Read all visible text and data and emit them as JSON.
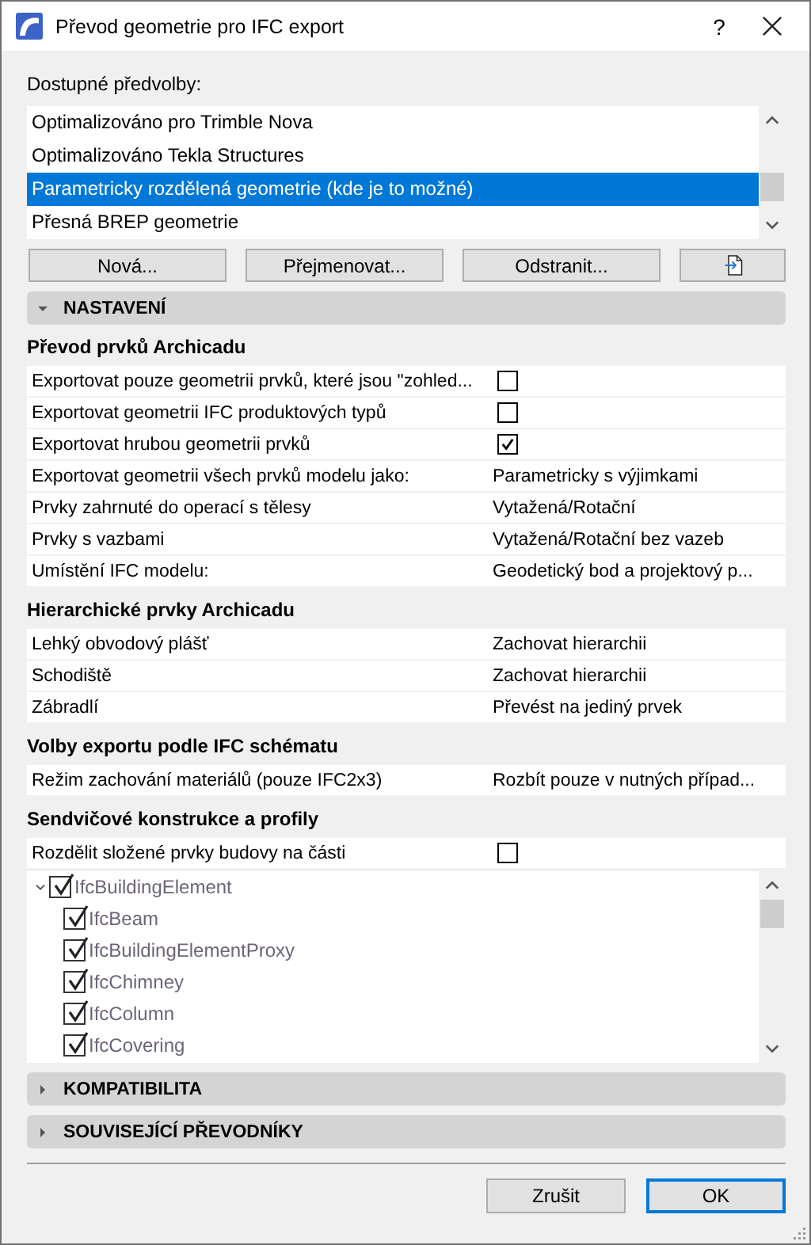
{
  "window": {
    "title": "Převod geometrie pro IFC export",
    "help": "?"
  },
  "presets": {
    "label": "Dostupné předvolby:",
    "items": [
      {
        "label": "Optimalizováno pro Trimble Nova",
        "selected": false
      },
      {
        "label": "Optimalizováno Tekla Structures",
        "selected": false
      },
      {
        "label": "Parametricky rozdělená geometrie (kde je to možné)",
        "selected": true
      },
      {
        "label": "Přesná BREP geometrie",
        "selected": false
      }
    ]
  },
  "preset_buttons": [
    "Nová...",
    "Přejmenovat...",
    "Odstranit..."
  ],
  "sections": [
    {
      "title": "NASTAVENÍ",
      "expanded": true,
      "groups": [
        {
          "title": "Převod prvků Archicadu",
          "rows": [
            {
              "kind": "checkbox",
              "label": "Exportovat pouze geometrii prvků, které jsou \"zohled...",
              "checked": false
            },
            {
              "kind": "checkbox",
              "label": "Exportovat geometrii IFC produktových typů",
              "checked": false
            },
            {
              "kind": "checkbox",
              "label": "Exportovat hrubou geometrii prvků",
              "checked": true
            },
            {
              "kind": "value",
              "label": "Exportovat geometrii všech prvků modelu jako:",
              "value": "Parametricky s výjimkami"
            },
            {
              "kind": "value",
              "label": "Prvky zahrnuté do operací s tělesy",
              "value": "Vytažená/Rotační"
            },
            {
              "kind": "value",
              "label": "Prvky s vazbami",
              "value": "Vytažená/Rotační bez vazeb"
            },
            {
              "kind": "value",
              "label": "Umístění IFC modelu:",
              "value": "Geodetický bod a projektový p..."
            }
          ]
        },
        {
          "title": "Hierarchické prvky Archicadu",
          "rows": [
            {
              "kind": "value",
              "label": "Lehký obvodový plášť",
              "value": "Zachovat hierarchii"
            },
            {
              "kind": "value",
              "label": "Schodiště",
              "value": "Zachovat hierarchii"
            },
            {
              "kind": "value",
              "label": "Zábradlí",
              "value": "Převést na jediný prvek"
            }
          ]
        },
        {
          "title": "Volby exportu podle IFC schématu",
          "rows": [
            {
              "kind": "value",
              "label": "Režim zachování materiálů (pouze IFC2x3)",
              "value": "Rozbít pouze v nutných případ..."
            }
          ]
        },
        {
          "title": "Sendvičové konstrukce a profily",
          "rows": [
            {
              "kind": "checkbox",
              "label": "Rozdělit složené prvky budovy na části",
              "checked": false
            }
          ],
          "tree": [
            {
              "label": "IfcBuildingElement",
              "checked": true,
              "expanded": true,
              "children": [
                {
                  "label": "IfcBeam",
                  "checked": true
                },
                {
                  "label": "IfcBuildingElementProxy",
                  "checked": true
                },
                {
                  "label": "IfcChimney",
                  "checked": true
                },
                {
                  "label": "IfcColumn",
                  "checked": true
                },
                {
                  "label": "IfcCovering",
                  "checked": true
                }
              ]
            }
          ]
        }
      ]
    },
    {
      "title": "KOMPATIBILITA",
      "expanded": false
    },
    {
      "title": "SOUVISEJÍCÍ PŘEVODNÍKY",
      "expanded": false
    }
  ],
  "footer_buttons": [
    {
      "label": "Zrušit",
      "default": false
    },
    {
      "label": "OK",
      "default": true
    }
  ]
}
